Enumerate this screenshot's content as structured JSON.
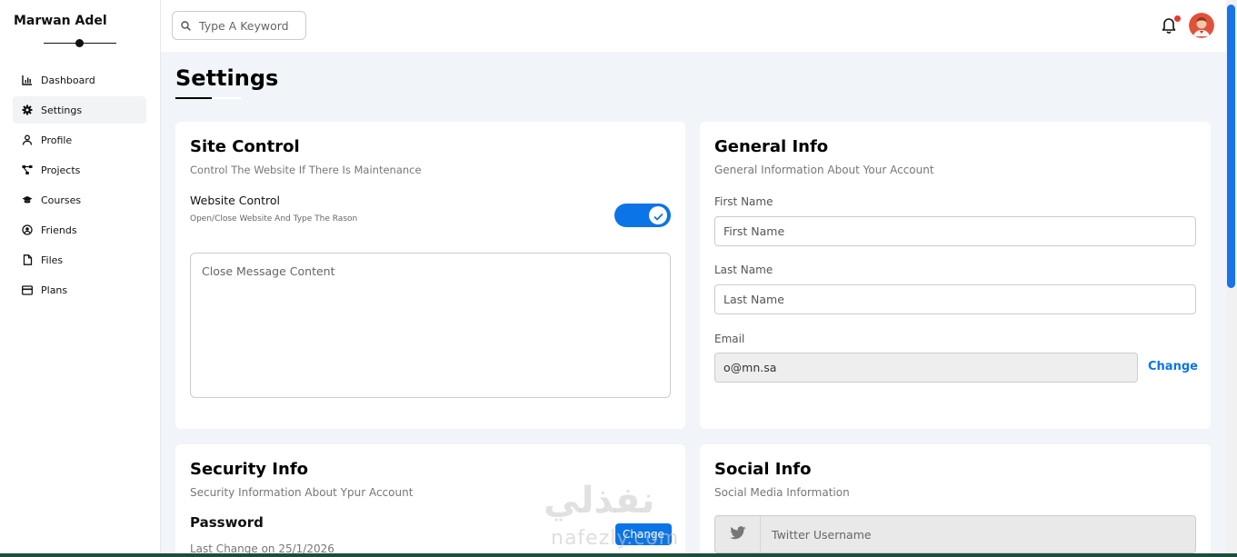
{
  "brand": {
    "name": "Marwan Adel"
  },
  "sidebar": {
    "items": [
      {
        "label": "Dashboard",
        "icon": "chart-icon",
        "active": false
      },
      {
        "label": "Settings",
        "icon": "gear-icon",
        "active": true
      },
      {
        "label": "Profile",
        "icon": "user-icon",
        "active": false
      },
      {
        "label": "Projects",
        "icon": "diagram-icon",
        "active": false
      },
      {
        "label": "Courses",
        "icon": "graduation-cap-icon",
        "active": false
      },
      {
        "label": "Friends",
        "icon": "user-circle-icon",
        "active": false
      },
      {
        "label": "Files",
        "icon": "file-icon",
        "active": false
      },
      {
        "label": "Plans",
        "icon": "credit-card-icon",
        "active": false
      }
    ]
  },
  "header": {
    "search_placeholder": "Type A Keyword",
    "notification_dot_color": "#e53935"
  },
  "page": {
    "title": "Settings"
  },
  "site_control": {
    "title": "Site Control",
    "subtitle": "Control The Website If There Is Maintenance",
    "toggle_label": "Website Control",
    "toggle_desc": "Open/Close Website And Type The Rason",
    "toggle_on": true,
    "message_placeholder": "Close Message Content"
  },
  "general_info": {
    "title": "General Info",
    "subtitle": "General Information About Your Account",
    "first_name_label": "First Name",
    "first_name_placeholder": "First Name",
    "last_name_label": "Last Name",
    "last_name_placeholder": "Last Name",
    "email_label": "Email",
    "email_value": "o@mn.sa",
    "change_label": "Change"
  },
  "security_info": {
    "title": "Security Info",
    "subtitle": "Security Information About Ypur Account",
    "password_label": "Password",
    "last_change": "Last Change on 25/1/2026",
    "change_button": "Change"
  },
  "social_info": {
    "title": "Social Info",
    "subtitle": "Social Media Information",
    "twitter_placeholder": "Twitter Username"
  },
  "watermark": {
    "arabic": "نفذلي",
    "latin": "nafezly.com"
  },
  "colors": {
    "accent": "#0b74e6",
    "background": "#f1f5f9"
  }
}
